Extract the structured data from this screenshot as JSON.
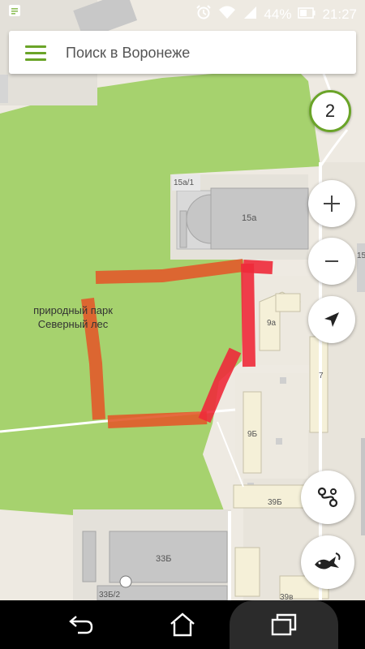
{
  "status_bar": {
    "battery_percent": "44%",
    "time": "21:27",
    "icons": [
      "notification-icon",
      "alarm-icon",
      "wifi-icon",
      "signal-icon",
      "battery-icon"
    ]
  },
  "search": {
    "placeholder": "Поиск в Воронеже",
    "menu_icon": "hamburger-menu-icon"
  },
  "map": {
    "park_label_line1": "природный парк",
    "park_label_line2": "Северный лес",
    "buildings": {
      "b15a1": "15а/1",
      "b15a": "15а",
      "b15": "15",
      "b9a": "9а",
      "b7": "7",
      "b9b": "9Б",
      "b39b": "39Б",
      "b33b": "33Б",
      "b33b2": "33Б/2",
      "b39v": "39в"
    },
    "colors": {
      "park": "#a6d26e",
      "route_orange": "#e25a2a",
      "route_red": "#ee2a3a",
      "accent": "#6aa428"
    }
  },
  "controls": {
    "badge_count": "2",
    "zoom_in_icon": "plus-icon",
    "zoom_out_icon": "minus-icon",
    "location_icon": "navigation-arrow-icon",
    "layers_icon": "route-icon",
    "extra_icon": "fish-icon"
  },
  "nav_bar": {
    "icons": [
      "back-icon",
      "home-icon",
      "recent-apps-icon"
    ]
  }
}
